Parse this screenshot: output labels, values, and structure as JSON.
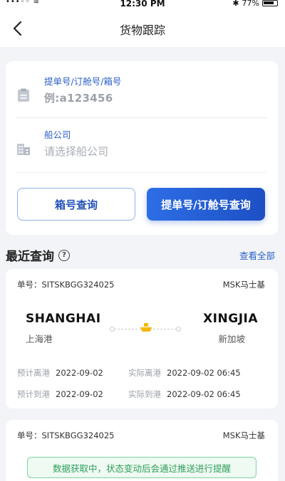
{
  "status_bar": {
    "left": "•••◦◦ ≋",
    "time": "12:30 PM",
    "battery_text": "77%"
  },
  "nav": {
    "title": "货物跟踪"
  },
  "form": {
    "bill_label": "提单号/订舱号/箱号",
    "bill_placeholder": "例:a123456",
    "carrier_label": "船公司",
    "carrier_placeholder": "请选择船公司",
    "box_query_button": "箱号查询",
    "bill_query_button": "提单号/订舱号查询"
  },
  "recent": {
    "title": "最近查询",
    "help_symbol": "?",
    "view_all": "查看全部",
    "records": [
      {
        "order_no": "单号：SITSKBGG324025",
        "carrier": "MSK马士基",
        "from_en": "SHANGHAI",
        "from_cn": "上海港",
        "to_en": "XINGJIA",
        "to_cn": "新加坡",
        "est_depart_label": "预计离港",
        "est_depart": "2022-09-02",
        "act_depart_label": "实际离港",
        "act_depart": "2022-09-02  06:45",
        "est_arrive_label": "预计到港",
        "est_arrive": "2022-09-02",
        "act_arrive_label": "实际到港",
        "act_arrive": "2022-09-02  06:45"
      },
      {
        "order_no": "单号：SITSKBGG324025",
        "carrier": "MSK马士基",
        "notice": "数据获取中，状态变动后会通过推送进行提醒"
      }
    ]
  },
  "colors": {
    "accent": "#2b5fc8",
    "button_gradient_start": "#2d6ee6",
    "button_gradient_end": "#1d4fc4",
    "ship_icon": "#f5b800",
    "notice_green": "#2f9e5c"
  }
}
